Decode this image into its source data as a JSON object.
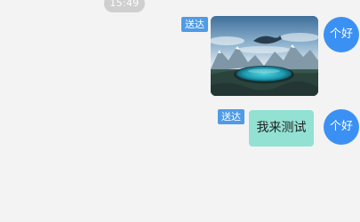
{
  "chat": {
    "timestamp": "15:49",
    "messages": [
      {
        "type": "image",
        "status": "送达",
        "avatar_text": "个好",
        "image_description_icon": "landscape-image-icon"
      },
      {
        "type": "text",
        "status": "送达",
        "text": "我来测试",
        "avatar_text": "个好"
      }
    ]
  },
  "colors": {
    "background": "#f3f3f3",
    "status_tag": "#4f9be6",
    "avatar": "#3b91f3",
    "text_bubble": "#92e1d3",
    "time_badge": "#cfcfcf"
  }
}
